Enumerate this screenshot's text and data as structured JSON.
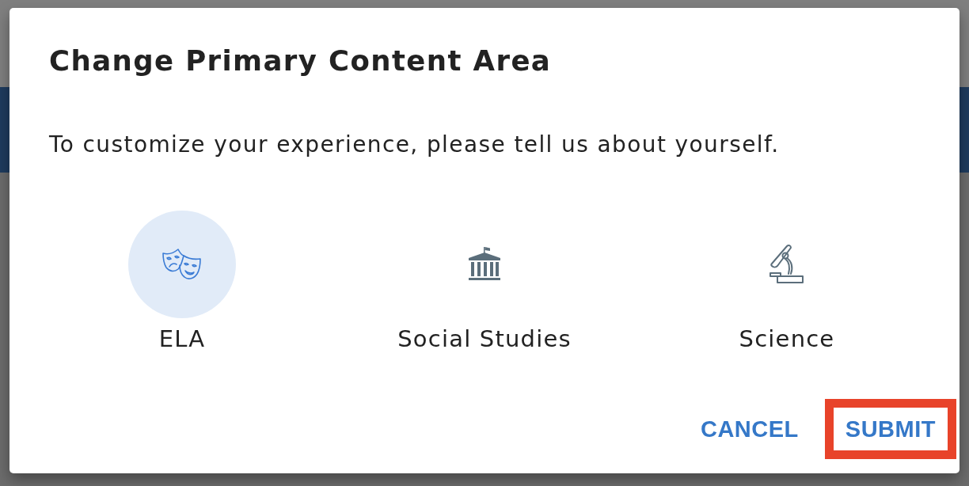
{
  "dialog": {
    "title": "Change Primary Content Area",
    "message": "To customize your experience, please tell us about yourself."
  },
  "options": [
    {
      "kind": "masks",
      "label": "ELA",
      "selected": true
    },
    {
      "kind": "building",
      "label": "Social Studies",
      "selected": false
    },
    {
      "kind": "microscope",
      "label": "Science",
      "selected": false
    }
  ],
  "buttons": [
    {
      "label": "CANCEL",
      "highlighted": false
    },
    {
      "label": "SUBMIT",
      "highlighted": true
    }
  ]
}
